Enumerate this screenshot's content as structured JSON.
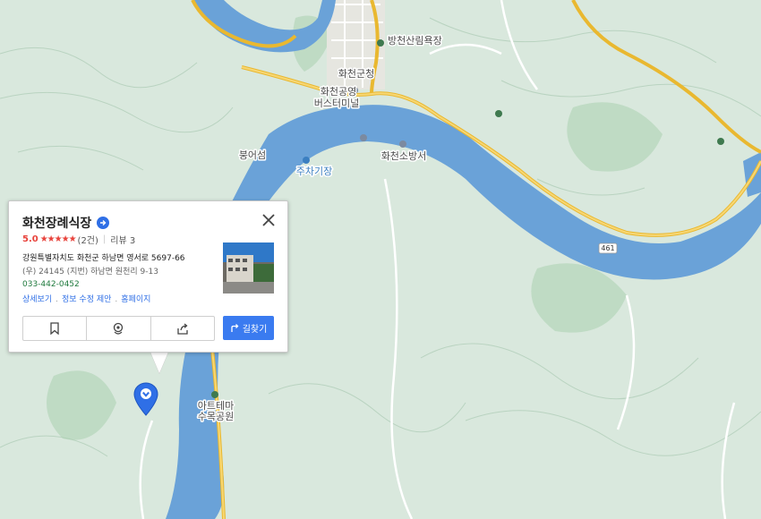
{
  "map": {
    "labels": [
      {
        "id": "lbl-forest",
        "text": "방천산림욕장"
      },
      {
        "id": "lbl-county",
        "text": "화천군청"
      },
      {
        "id": "lbl-terminal-1",
        "text": "화천공영"
      },
      {
        "id": "lbl-terminal-2",
        "text": "버스터미널"
      },
      {
        "id": "lbl-island",
        "text": "붕어섬"
      },
      {
        "id": "lbl-parking",
        "text": "주차기장"
      },
      {
        "id": "lbl-fire",
        "text": "화천소방서"
      },
      {
        "id": "lbl-park-1",
        "text": "아트테마"
      },
      {
        "id": "lbl-park-2",
        "text": "수목공원"
      }
    ],
    "road_badge": "461",
    "colors": {
      "land": "#d9e8dd",
      "water": "#6aa2d8",
      "road_major": "#f2c94c",
      "road_minor": "#ffffff",
      "contour": "#b8d0bd"
    }
  },
  "place": {
    "name": "화천장례식장",
    "score": "5.0",
    "stars": "★★★★★",
    "review_count": "(2건)",
    "review_label": "리뷰 3",
    "road_address": "강원특별자치도 화천군 하남면 영서로 5697-66",
    "postal_address": "(우) 24145  (지번) 하남면 원천리 9-13",
    "phone": "033-442-0452",
    "links": [
      "상세보기",
      "정보 수정 제안",
      "홈페이지"
    ],
    "route_label": "길찾기",
    "accent_color": "#3a7bf0",
    "rating_color": "#e8433c"
  }
}
